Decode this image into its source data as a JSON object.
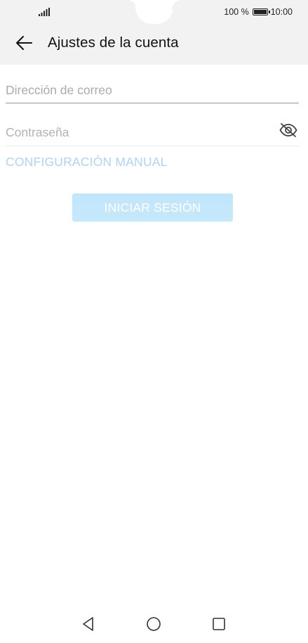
{
  "status_bar": {
    "signal_icon": "signal-bars-icon",
    "battery_percent": "100 %",
    "battery_icon": "battery-full-icon",
    "time": "10:00"
  },
  "app_bar": {
    "back_icon": "arrow-left-icon",
    "title": "Ajustes de la cuenta"
  },
  "form": {
    "email": {
      "value": "",
      "placeholder": "Dirección de correo"
    },
    "password": {
      "value": "",
      "placeholder": "Contraseña",
      "visibility_icon": "eye-off-icon"
    },
    "manual_setup_label": "CONFIGURACIÓN MANUAL",
    "login_label": "INICIAR SESIÓN"
  },
  "nav_bar": {
    "back_icon": "triangle-back-icon",
    "home_icon": "circle-home-icon",
    "recent_icon": "square-recent-icon"
  },
  "colors": {
    "header_bg": "#f2f2f2",
    "link": "#9bc8ee",
    "button_bg": "#a9dcfa",
    "button_text": "#ffffff"
  }
}
